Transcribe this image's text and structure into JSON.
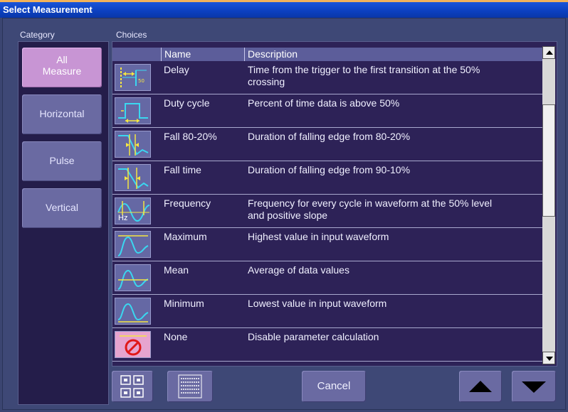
{
  "window": {
    "title": "Select Measurement"
  },
  "category": {
    "header": "Category",
    "items": [
      {
        "line1": "All",
        "line2": "Measure",
        "active": true
      },
      {
        "line1": "Horizontal",
        "line2": "",
        "active": false
      },
      {
        "line1": "Pulse",
        "line2": "",
        "active": false
      },
      {
        "line1": "Vertical",
        "line2": "",
        "active": false
      }
    ]
  },
  "choices": {
    "header": "Choices",
    "columns": {
      "icon": "",
      "name": "Name",
      "description": "Description"
    },
    "rows": [
      {
        "name": "Delay",
        "desc1": "Time from the trigger to the first transition at the 50%",
        "desc2": "crossing",
        "icon": "delay-icon"
      },
      {
        "name": "Duty cycle",
        "desc1": "Percent of time data is above 50%",
        "desc2": "",
        "icon": "duty-cycle-icon"
      },
      {
        "name": "Fall 80-20%",
        "desc1": "Duration of falling edge from 80-20%",
        "desc2": "",
        "icon": "fall-80-20-icon"
      },
      {
        "name": "Fall time",
        "desc1": "Duration of falling edge from 90-10%",
        "desc2": "",
        "icon": "fall-time-icon"
      },
      {
        "name": "Frequency",
        "desc1": "Frequency for every cycle in waveform at the 50% level",
        "desc2": "and positive slope",
        "icon": "frequency-icon",
        "icon_text": "Hz"
      },
      {
        "name": "Maximum",
        "desc1": "Highest value in input waveform",
        "desc2": "",
        "icon": "maximum-icon"
      },
      {
        "name": "Mean",
        "desc1": "Average of data values",
        "desc2": "",
        "icon": "mean-icon"
      },
      {
        "name": "Minimum",
        "desc1": "Lowest value in input waveform",
        "desc2": "",
        "icon": "minimum-icon"
      },
      {
        "name": "None",
        "desc1": "Disable parameter calculation",
        "desc2": "",
        "icon": "none-icon"
      }
    ]
  },
  "footer": {
    "cancel_label": "Cancel"
  },
  "colors": {
    "accent": "#c895d4",
    "panel": "#2d2257",
    "button": "#6a6aa2",
    "trace": "#3ad7f0",
    "marker": "#f5e642"
  }
}
